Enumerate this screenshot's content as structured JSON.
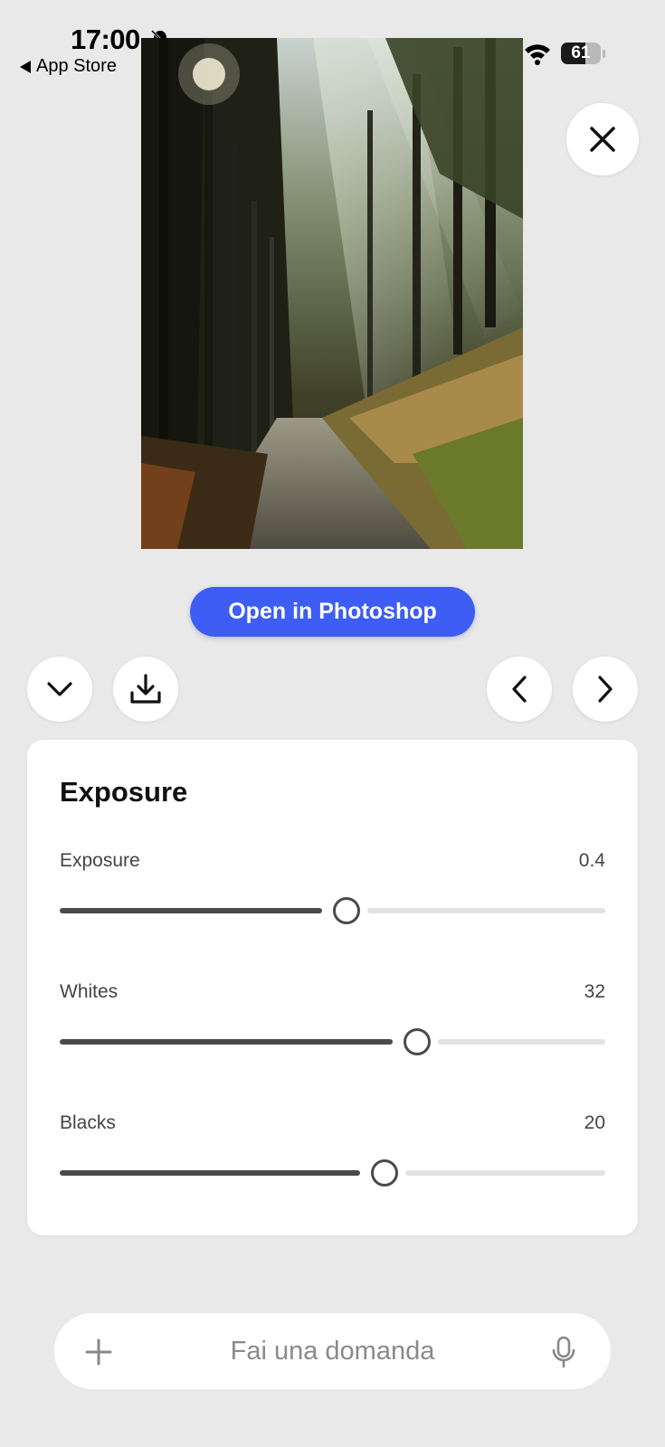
{
  "status_bar": {
    "time": "17:00",
    "back_app": "App Store",
    "battery_percent": 61
  },
  "photo": {
    "subject_icon": "forest-path-photo"
  },
  "actions": {
    "open_in_photoshop": "Open in Photoshop"
  },
  "panel": {
    "title": "Exposure",
    "sliders": [
      {
        "label": "Exposure",
        "value": "0.4",
        "level": 0.52
      },
      {
        "label": "Whites",
        "value": "32",
        "level": 0.65
      },
      {
        "label": "Blacks",
        "value": "20",
        "level": 0.59
      }
    ]
  },
  "ask": {
    "placeholder": "Fai una domanda"
  },
  "colors": {
    "accent": "#3d5df5",
    "background": "#e9e9e9",
    "slider_active": "#4a4a4a",
    "slider_inactive": "#e2e2e2"
  }
}
